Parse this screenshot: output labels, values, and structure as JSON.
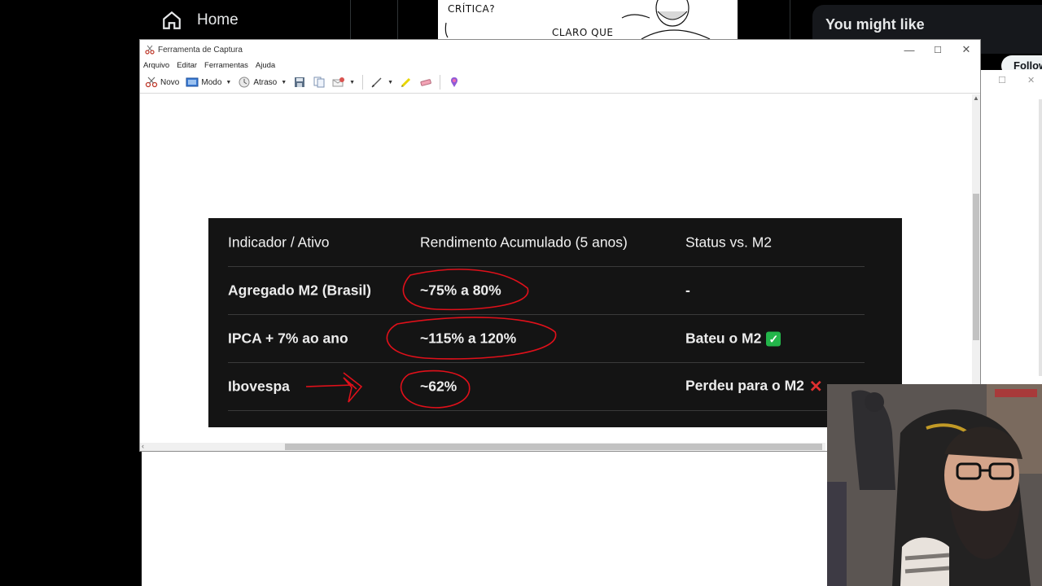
{
  "background": {
    "nav_home_label": "Home",
    "comic_text_1": "CRÍTICA?",
    "comic_text_2": "CLARO QUE",
    "card_title": "You might like",
    "follow_label": "Follow"
  },
  "window": {
    "title": "Ferramenta de Captura",
    "menu": [
      "Arquivo",
      "Editar",
      "Ferramentas",
      "Ajuda"
    ],
    "toolbar": {
      "new_label": "Novo",
      "mode_label": "Modo",
      "delay_label": "Atraso"
    }
  },
  "table": {
    "headers": [
      "Indicador / Ativo",
      "Rendimento Acumulado (5 anos)",
      "Status vs. M2"
    ],
    "rows": [
      {
        "asset": "Agregado M2 (Brasil)",
        "return": "~75% a 80%",
        "status": "-"
      },
      {
        "asset": "IPCA + 7% ao ano",
        "return": "~115% a 120%",
        "status": "Bateu o M2"
      },
      {
        "asset": "Ibovespa",
        "return": "~62%",
        "status": "Perdeu para o M2"
      }
    ],
    "status_icons": [
      "",
      "check-mark",
      "cross-mark"
    ]
  },
  "colors": {
    "table_bg": "#141414",
    "annotation_red": "#e0101a",
    "check_green": "#23b54a"
  }
}
